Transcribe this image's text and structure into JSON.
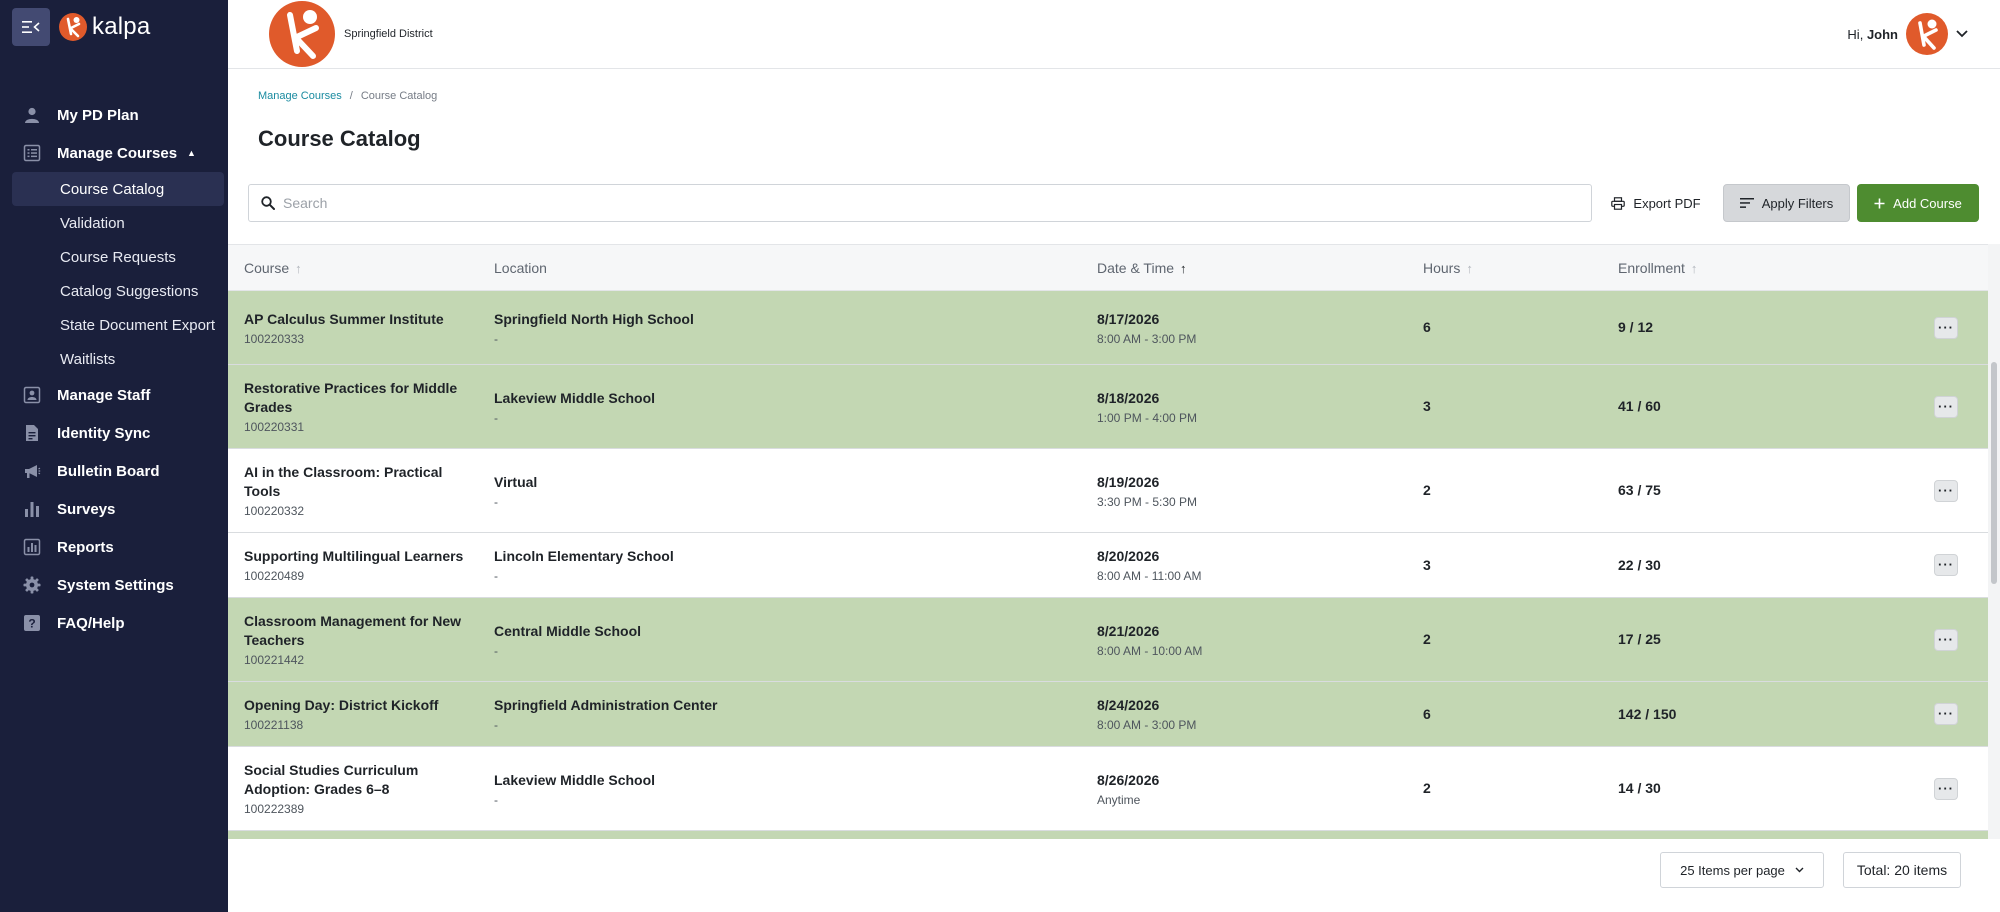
{
  "app": {
    "brand": "kalpa",
    "accent": "#e05a2b",
    "sidebar_bg": "#1a1f3b",
    "row_highlight": "#c3d7b3",
    "primary_button": "#4e8c30"
  },
  "header": {
    "district": "Springfield District",
    "greeting_prefix": "Hi,",
    "user_name": "John"
  },
  "sidebar": {
    "items": [
      {
        "label": "My PD Plan",
        "icon": "person-icon"
      },
      {
        "label": "Manage Courses",
        "icon": "list-icon",
        "expanded": true,
        "children": [
          "Course Catalog",
          "Validation",
          "Course Requests",
          "Catalog Suggestions",
          "State Document Export",
          "Waitlists"
        ]
      },
      {
        "label": "Manage Staff",
        "icon": "badge-icon"
      },
      {
        "label": "Identity Sync",
        "icon": "document-icon"
      },
      {
        "label": "Bulletin Board",
        "icon": "megaphone-icon"
      },
      {
        "label": "Surveys",
        "icon": "bar-chart-icon"
      },
      {
        "label": "Reports",
        "icon": "report-icon"
      },
      {
        "label": "System Settings",
        "icon": "gear-icon"
      },
      {
        "label": "FAQ/Help",
        "icon": "help-icon"
      }
    ],
    "active_child": "Course Catalog"
  },
  "breadcrumb": {
    "parent": "Manage Courses",
    "separator": "/",
    "current": "Course Catalog"
  },
  "page": {
    "title": "Course Catalog"
  },
  "search": {
    "placeholder": "Search",
    "value": ""
  },
  "toolbar": {
    "export_label": "Export PDF",
    "filters_label": "Apply Filters",
    "add_label": "Add Course"
  },
  "table": {
    "columns": [
      {
        "label": "Course",
        "sort": "none"
      },
      {
        "label": "Location",
        "sort": "unsortable"
      },
      {
        "label": "Date & Time",
        "sort": "asc"
      },
      {
        "label": "Hours",
        "sort": "none"
      },
      {
        "label": "Enrollment",
        "sort": "none"
      }
    ],
    "rows": [
      {
        "course": "AP Calculus Summer Institute",
        "id": "100220333",
        "location": "Springfield North High School",
        "location_sub": "-",
        "date": "8/17/2026",
        "time": "8:00 AM - 3:00 PM",
        "hours": "6",
        "enrollment": "9 / 12",
        "highlight": true
      },
      {
        "course": "Restorative Practices for Middle Grades",
        "id": "100220331",
        "location": "Lakeview Middle School",
        "location_sub": "-",
        "date": "8/18/2026",
        "time": "1:00 PM - 4:00 PM",
        "hours": "3",
        "enrollment": "41 / 60",
        "highlight": true
      },
      {
        "course": "AI in the Classroom: Practical Tools",
        "id": "100220332",
        "location": "Virtual",
        "location_sub": "-",
        "date": "8/19/2026",
        "time": "3:30 PM - 5:30 PM",
        "hours": "2",
        "enrollment": "63 / 75",
        "highlight": false
      },
      {
        "course": "Supporting Multilingual Learners",
        "id": "100220489",
        "location": "Lincoln Elementary School",
        "location_sub": "-",
        "date": "8/20/2026",
        "time": "8:00 AM - 11:00 AM",
        "hours": "3",
        "enrollment": "22 / 30",
        "highlight": false
      },
      {
        "course": "Classroom Management for New Teachers",
        "id": "100221442",
        "location": "Central Middle School",
        "location_sub": "-",
        "date": "8/21/2026",
        "time": "8:00 AM - 10:00 AM",
        "hours": "2",
        "enrollment": "17 / 25",
        "highlight": true
      },
      {
        "course": "Opening Day: District Kickoff",
        "id": "100221138",
        "location": "Springfield Administration Center",
        "location_sub": "-",
        "date": "8/24/2026",
        "time": "8:00 AM - 3:00 PM",
        "hours": "6",
        "enrollment": "142 / 150",
        "highlight": true
      },
      {
        "course": "Social Studies Curriculum Adoption: Grades 6–8",
        "id": "100222389",
        "location": "Lakeview Middle School",
        "location_sub": "-",
        "date": "8/26/2026",
        "time": "Anytime",
        "hours": "2",
        "enrollment": "14 / 30",
        "highlight": false
      },
      {
        "course": "",
        "id": "",
        "location": "",
        "location_sub": "",
        "date": "",
        "time": "",
        "hours": "",
        "enrollment": "",
        "highlight": true
      }
    ],
    "more_glyph": "···"
  },
  "footer": {
    "per_page": "25 Items per page",
    "total": "Total: 20 items"
  }
}
